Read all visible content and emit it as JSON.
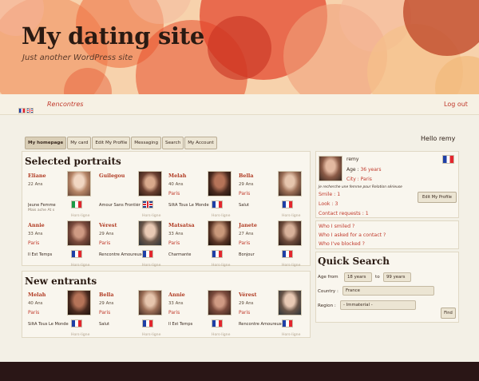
{
  "site": {
    "title": "My dating site",
    "tagline": "Just another WordPress site"
  },
  "topnav": {
    "link": "Rencontres",
    "logout": "Log out"
  },
  "tabs": [
    "My homepage",
    "My card",
    "Edit My Profile",
    "Messaging",
    "Search",
    "My Account"
  ],
  "hello": "Hello remy",
  "selected": {
    "title": "Selected portraits",
    "cards": [
      {
        "name": "Eliane",
        "age": "22 Ans",
        "city": "",
        "tag": "Jeune Femme",
        "tag2": "Mais  ache  At  s",
        "flag": "it",
        "status": "Hors-ligne"
      },
      {
        "name": "Guilegou",
        "age": "",
        "city": "",
        "tag": "Amour Sans Frontière",
        "tag2": "",
        "flag": "uk",
        "status": "Hors-ligne"
      },
      {
        "name": "Melah",
        "age": "40 Ans",
        "city": "Paris",
        "tag": "SiltA Tous Le Monde",
        "tag2": "",
        "flag": "fr",
        "status": "Hors-ligne"
      },
      {
        "name": "Bella",
        "age": "29 Ans",
        "city": "Paris",
        "tag": "Salut",
        "tag2": "",
        "flag": "fr",
        "status": "Hors-ligne"
      },
      {
        "name": "Annie",
        "age": "33 Ans",
        "city": "Paris",
        "tag": "Il Est Temps",
        "tag2": "",
        "flag": "fr",
        "status": "Hors-ligne"
      },
      {
        "name": "Vérest",
        "age": "29 Ans",
        "city": "Paris",
        "tag": "Rencontre Amoureuse",
        "tag2": "",
        "flag": "fr",
        "status": "Hors-ligne"
      },
      {
        "name": "Matsatsa",
        "age": "33 Ans",
        "city": "Paris",
        "tag": "Charmante",
        "tag2": "",
        "flag": "fr",
        "status": "Hors-ligne"
      },
      {
        "name": "Janete",
        "age": "27 Ans",
        "city": "Paris",
        "tag": "Bonjour",
        "tag2": "",
        "flag": "fr",
        "status": "Hors-ligne"
      }
    ]
  },
  "entrants": {
    "title": "New entrants",
    "cards": [
      {
        "name": "Melah",
        "age": "40 Ans",
        "city": "Paris",
        "tag": "SiltA Tous Le Monde",
        "flag": "fr",
        "status": "Hors-ligne"
      },
      {
        "name": "Bella",
        "age": "29 Ans",
        "city": "Paris",
        "tag": "Salut",
        "flag": "fr",
        "status": "Hors-ligne"
      },
      {
        "name": "Annie",
        "age": "33 Ans",
        "city": "Paris",
        "tag": "Il Est Temps",
        "flag": "fr",
        "status": "Hors-ligne"
      },
      {
        "name": "Vérest",
        "age": "29 Ans",
        "city": "Paris",
        "tag": "Rencontre Amoureuse",
        "flag": "fr",
        "status": "Hors-ligne"
      }
    ]
  },
  "profile": {
    "username": "remy",
    "age_label": "Age :",
    "age_value": "36 years",
    "city_label": "City :",
    "city_value": "Paris",
    "search_text": "Je recherche une femme pour Relation sérieuse",
    "smile": "Smile : 1",
    "look": "Look : 3",
    "contact_requests": "Contact requests : 1",
    "edit_button": "Edit My Profile"
  },
  "links": {
    "smiled": "Who I smiled ?",
    "asked": "Who I asked for a contact ?",
    "blocked": "Who I've blocked ?"
  },
  "quick_search": {
    "title": "Quick Search",
    "age_label": "Age from",
    "age_from": "18 years",
    "to_label": "to",
    "age_to": "99 years",
    "country_label": "Country :",
    "country_value": "France",
    "region_label": "Region :",
    "region_value": "- Immaterial -",
    "find_button": "Find"
  }
}
